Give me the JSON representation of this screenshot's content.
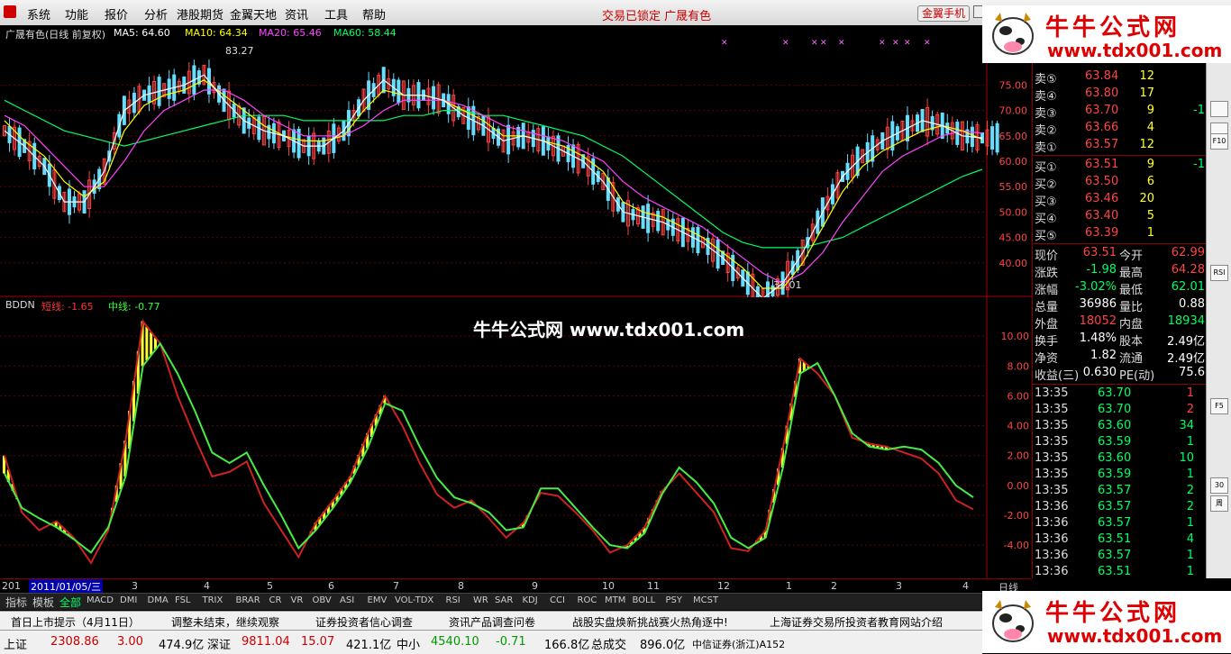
{
  "menu": {
    "items": [
      "系统",
      "功能",
      "报价",
      "分析",
      "港股期货",
      "金翼天地",
      "资讯",
      "工具",
      "帮助"
    ],
    "lock_status": "交易已锁定",
    "stock_name": "广晟有色",
    "gold_phone": "金翼手机"
  },
  "price_chart": {
    "title": "广晟有色(日线 前复权)",
    "ma5": "MA5: 64.60",
    "ma10": "MA10: 64.34",
    "ma20": "MA20: 65.46",
    "ma60": "MA60: 58.44",
    "high_label": "83.27",
    "low_label": "32.01",
    "y_ticks": [
      "75.00",
      "70.00",
      "65.00",
      "60.00",
      "55.00",
      "50.00",
      "45.00",
      "40.00"
    ],
    "colors": {
      "ma5": "#ffffff",
      "ma10": "#ffff00",
      "ma20": "#ff44ff",
      "ma60": "#00ff66",
      "up": "#ff4444",
      "down": "#66ddff"
    }
  },
  "indicator_chart": {
    "name": "BDDN",
    "short_line": "短线: -1.65",
    "mid_line": "中线: -0.77",
    "y_ticks": [
      "10.00",
      "8.00",
      "6.00",
      "4.00",
      "2.00",
      "0.00",
      "-2.00",
      "-4.00"
    ]
  },
  "chart_data": {
    "type": "line",
    "title": "BDDN",
    "series": [
      {
        "name": "短线",
        "values": [
          2.0,
          -1.8,
          -3.0,
          -2.4,
          -3.5,
          -5.2,
          -3.0,
          3.0,
          11.0,
          9.5,
          6.0,
          3.2,
          0.6,
          0.9,
          1.6,
          -1.2,
          -3.0,
          -4.8,
          -2.5,
          -1.0,
          0.6,
          3.5,
          6.0,
          4.0,
          1.5,
          -0.6,
          -1.5,
          -1.0,
          -2.2,
          -3.5,
          -2.5,
          -0.5,
          -0.7,
          -1.8,
          -3.0,
          -4.5,
          -4.0,
          -2.8,
          -0.4,
          0.8,
          -0.5,
          -1.8,
          -4.2,
          -4.4,
          -3.0,
          2.5,
          8.5,
          7.5,
          6.0,
          3.2,
          2.8,
          2.6,
          2.2,
          1.8,
          0.8,
          -1.0,
          -1.6
        ]
      },
      {
        "name": "中线",
        "values": [
          0.8,
          -1.5,
          -2.2,
          -2.8,
          -3.6,
          -4.5,
          -2.8,
          0.6,
          8.0,
          9.5,
          7.5,
          5.0,
          2.2,
          1.5,
          2.2,
          0.0,
          -2.0,
          -4.2,
          -3.0,
          -1.5,
          0.2,
          2.5,
          5.5,
          5.0,
          2.6,
          0.5,
          -0.8,
          -1.2,
          -1.8,
          -3.0,
          -2.8,
          -0.2,
          -0.2,
          -1.5,
          -2.8,
          -4.0,
          -4.2,
          -3.2,
          -0.6,
          1.2,
          0.2,
          -1.2,
          -3.5,
          -4.2,
          -3.5,
          1.2,
          7.5,
          8.2,
          6.0,
          3.5,
          2.6,
          2.4,
          2.6,
          2.4,
          1.5,
          0.0,
          -0.8
        ]
      }
    ],
    "ylim": [
      -5.5,
      12.0
    ]
  },
  "price_series": {
    "ma5": [
      66,
      63,
      59,
      52,
      52,
      58,
      70,
      73,
      74,
      75,
      77,
      72,
      68,
      66,
      65,
      63,
      63,
      66,
      72,
      76,
      73,
      73,
      72,
      69,
      67,
      64,
      65,
      64,
      62,
      60,
      56,
      50,
      49,
      48,
      46,
      44,
      41,
      37,
      33,
      36,
      42,
      50,
      57,
      61,
      64,
      66,
      68,
      67,
      65,
      64.6
    ],
    "ma10": [
      68,
      64,
      61,
      56,
      53,
      56,
      66,
      71,
      73,
      74,
      76,
      73,
      70,
      67,
      65,
      64,
      64,
      65,
      70,
      74,
      73,
      73,
      72,
      70,
      68,
      65,
      65,
      64,
      63,
      61,
      58,
      52,
      50,
      49,
      47,
      45,
      42,
      39,
      35,
      35,
      40,
      47,
      54,
      59,
      62,
      64,
      66,
      67,
      66,
      64.3
    ],
    "ma20": [
      69,
      67,
      63,
      59,
      55,
      55,
      60,
      66,
      70,
      72,
      74,
      74,
      72,
      69,
      67,
      65,
      65,
      65,
      67,
      70,
      72,
      72,
      72,
      71,
      69,
      67,
      66,
      65,
      64,
      62,
      60,
      56,
      53,
      51,
      49,
      47,
      44,
      41,
      38,
      36,
      38,
      42,
      48,
      53,
      58,
      61,
      63,
      65,
      66,
      65.5
    ],
    "ma60": [
      72,
      70,
      68,
      66,
      65,
      64,
      63,
      64,
      65,
      66,
      67,
      68,
      69,
      69,
      69,
      68,
      68,
      68,
      68,
      68,
      69,
      69,
      70,
      70,
      69,
      69,
      68,
      67,
      66,
      65,
      63,
      61,
      58,
      55,
      52,
      49,
      46,
      44,
      43,
      43,
      43,
      44,
      45,
      47,
      49,
      51,
      53,
      55,
      57,
      58.4
    ]
  },
  "quote": {
    "sells": [
      {
        "label": "卖⑤",
        "price": "63.84",
        "vol": "12",
        "chg": ""
      },
      {
        "label": "卖④",
        "price": "63.80",
        "vol": "17",
        "chg": ""
      },
      {
        "label": "卖③",
        "price": "63.70",
        "vol": "9",
        "chg": "-1"
      },
      {
        "label": "卖②",
        "price": "63.66",
        "vol": "4",
        "chg": ""
      },
      {
        "label": "卖①",
        "price": "63.57",
        "vol": "12",
        "chg": ""
      }
    ],
    "buys": [
      {
        "label": "买①",
        "price": "63.51",
        "vol": "9",
        "chg": "-1"
      },
      {
        "label": "买②",
        "price": "63.50",
        "vol": "6",
        "chg": ""
      },
      {
        "label": "买③",
        "price": "63.46",
        "vol": "20",
        "chg": ""
      },
      {
        "label": "买④",
        "price": "63.40",
        "vol": "5",
        "chg": ""
      },
      {
        "label": "买⑤",
        "price": "63.39",
        "vol": "1",
        "chg": ""
      }
    ],
    "stats": [
      {
        "l1": "现价",
        "v1": "63.51",
        "l2": "今开",
        "v2": "62.99"
      },
      {
        "l1": "涨跌",
        "v1": "-1.98",
        "l2": "最高",
        "v2": "64.28"
      },
      {
        "l1": "涨幅",
        "v1": "-3.02%",
        "l2": "最低",
        "v2": "62.01"
      },
      {
        "l1": "总量",
        "v1": "36986",
        "l2": "量比",
        "v2": "0.88"
      },
      {
        "l1": "外盘",
        "v1": "18052",
        "l2": "内盘",
        "v2": "18934"
      },
      {
        "l1": "换手",
        "v1": "1.48%",
        "l2": "股本",
        "v2": "2.49亿"
      },
      {
        "l1": "净资",
        "v1": "1.82",
        "l2": "流通",
        "v2": "2.49亿"
      },
      {
        "l1": "收益(三)",
        "v1": "0.630",
        "l2": "PE(动)",
        "v2": "75.6"
      }
    ],
    "ticks": [
      {
        "t": "13:35",
        "p": "63.70",
        "v": "1"
      },
      {
        "t": "13:35",
        "p": "63.70",
        "v": "2"
      },
      {
        "t": "13:35",
        "p": "63.60",
        "v": "34"
      },
      {
        "t": "13:35",
        "p": "63.59",
        "v": "1"
      },
      {
        "t": "13:35",
        "p": "63.60",
        "v": "10"
      },
      {
        "t": "13:35",
        "p": "63.59",
        "v": "1"
      },
      {
        "t": "13:35",
        "p": "63.57",
        "v": "2"
      },
      {
        "t": "13:36",
        "p": "63.57",
        "v": "2"
      },
      {
        "t": "13:36",
        "p": "63.57",
        "v": "1"
      },
      {
        "t": "13:36",
        "p": "63.51",
        "v": "4"
      },
      {
        "t": "13:36",
        "p": "63.57",
        "v": "1"
      },
      {
        "t": "13:36",
        "p": "63.51",
        "v": "1"
      }
    ]
  },
  "right_icons": [
    "F10",
    "RSI",
    "F5",
    "30",
    "周"
  ],
  "date_axis": {
    "current_date": "2011/01/05/三",
    "prefix": "201",
    "months": [
      "3",
      "4",
      "5",
      "6",
      "7",
      "8",
      "9",
      "10",
      "11",
      "12",
      "1",
      "2",
      "3",
      "4"
    ],
    "period": "日线"
  },
  "tabs": [
    "指标",
    "模板",
    "全部",
    "MACD",
    "DMI",
    "DMA",
    "FSL",
    "TRIX",
    "BRAR",
    "CR",
    "VR",
    "OBV",
    "ASI",
    "EMV",
    "VOL-TDX",
    "RSI",
    "WR",
    "SAR",
    "KDJ",
    "CCI",
    "ROC",
    "MTM",
    "BOLL",
    "PSY",
    "MCST"
  ],
  "news": [
    "首日上市提示（4月11日）",
    "调整未结束，继续观察",
    "证券投资者信心调查",
    "资讯产品调查问卷",
    "战股实盘焕新挑战赛火热角逐中!",
    "上海证券交易所投资者教育网站介绍"
  ],
  "status": [
    {
      "name": "上证",
      "val": "2308.86",
      "chg": "3.00",
      "amt": "474.9亿"
    },
    {
      "name": "深证",
      "val": "9811.04",
      "chg": "15.07",
      "amt": "421.1亿"
    },
    {
      "name": "中小",
      "val": "4540.10",
      "chg": "-0.71",
      "amt": "166.8亿"
    }
  ],
  "status_total": {
    "label": "总成交",
    "val": "896.0亿"
  },
  "broker": "中信证券(浙江)A152",
  "watermark": "牛牛公式网 www.tdx001.com",
  "logo": {
    "cn": "牛牛公式网",
    "url": "www.tdx001.com"
  }
}
